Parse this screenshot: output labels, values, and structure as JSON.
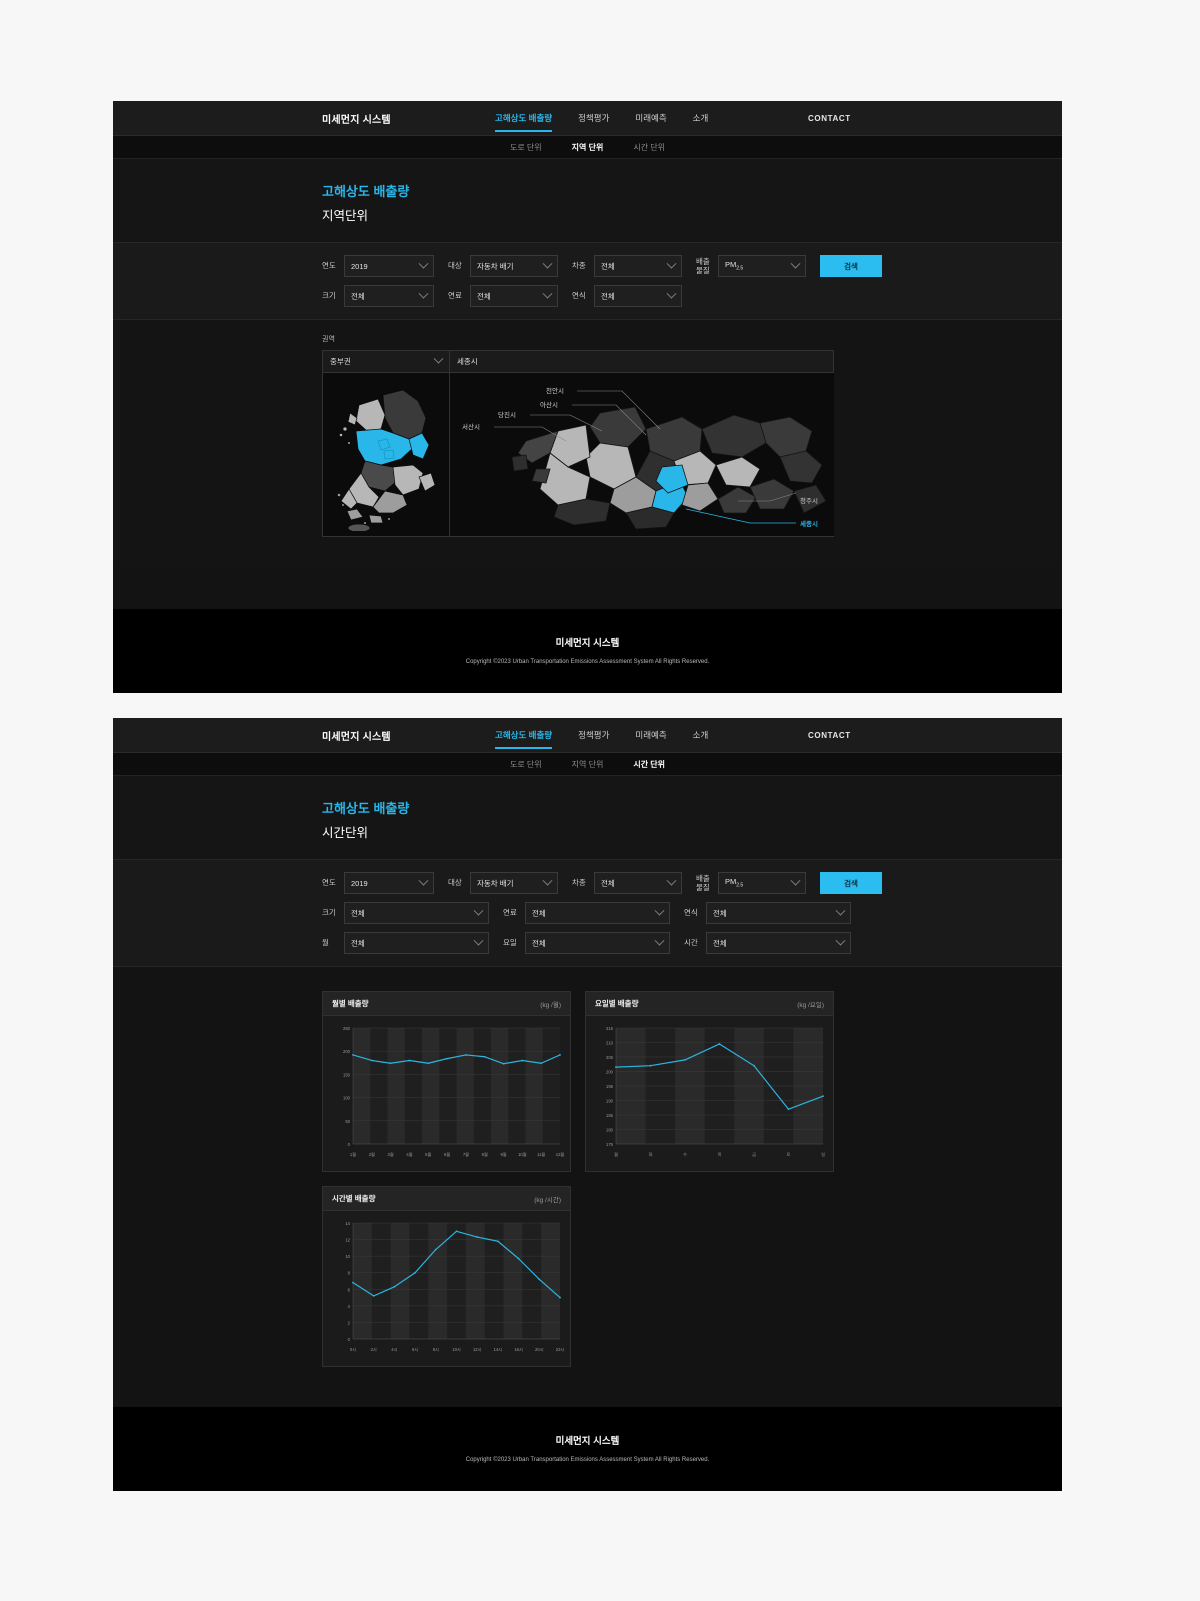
{
  "nav": {
    "brand": "미세먼지 시스템",
    "links": [
      {
        "label": "고해상도 배출량",
        "active": true
      },
      {
        "label": "정책평가",
        "active": false
      },
      {
        "label": "미래예측",
        "active": false
      },
      {
        "label": "소개",
        "active": false
      }
    ],
    "contact": "CONTACT"
  },
  "subnav": {
    "items": [
      {
        "label": "도로 단위"
      },
      {
        "label": "지역 단위"
      },
      {
        "label": "시간 단위"
      }
    ]
  },
  "region_page": {
    "heading": {
      "kicker": "고해상도 배출량",
      "title": "지역단위"
    },
    "filters": {
      "row1": [
        {
          "label": "연도",
          "value": "2019"
        },
        {
          "label": "대상",
          "value": "자동차 배기"
        },
        {
          "label": "차종",
          "value": "전체"
        },
        {
          "label": "배출\n물질",
          "value": "PM",
          "sub": "2.5"
        }
      ],
      "row2": [
        {
          "label": "크기",
          "value": "전체"
        },
        {
          "label": "연료",
          "value": "전체"
        },
        {
          "label": "연식",
          "value": "전체"
        }
      ],
      "search_label": "검색"
    },
    "map": {
      "caption": "권역",
      "region_select": "중부권",
      "city_title": "세종시",
      "labels": [
        "천안시",
        "아산시",
        "당진시",
        "서산시",
        "청주시",
        "세종시"
      ]
    }
  },
  "time_page": {
    "heading": {
      "kicker": "고해상도 배출량",
      "title": "시간단위"
    },
    "filters": {
      "row1": [
        {
          "label": "연도",
          "value": "2019"
        },
        {
          "label": "대상",
          "value": "자동차 배기"
        },
        {
          "label": "차종",
          "value": "전체"
        },
        {
          "label": "배출\n물질",
          "value": "PM",
          "sub": "2.5"
        }
      ],
      "row2": [
        {
          "label": "크기",
          "value": "전체"
        },
        {
          "label": "연료",
          "value": "전체"
        },
        {
          "label": "연식",
          "value": "전체"
        }
      ],
      "row3": [
        {
          "label": "월",
          "value": "전체"
        },
        {
          "label": "요일",
          "value": "전체"
        },
        {
          "label": "시간",
          "value": "전체"
        }
      ],
      "search_label": "검색"
    },
    "cards": [
      {
        "title": "월별 배출량",
        "unit": "(kg /월)"
      },
      {
        "title": "요일별 배출량",
        "unit": "(kg /요일)"
      },
      {
        "title": "시간별 배출량",
        "unit": "(kg /시간)"
      }
    ]
  },
  "footer": {
    "brand": "미세먼지 시스템",
    "copyright": "Copyright ©2023 Urban Transportation Emissions Assessment System All Rights Reserved."
  },
  "colors": {
    "accent": "#29b6e8",
    "line": "#2bb5e0",
    "map_highlight": "#29b6e8",
    "map_light": "#b7b7b7",
    "map_dark": "#3a3a3a"
  },
  "chart_data": [
    {
      "type": "line",
      "title": "월별 배출량",
      "unit": "(kg /월)",
      "xlabel": "",
      "ylabel": "",
      "categories": [
        "1월",
        "2월",
        "3월",
        "4월",
        "5월",
        "6월",
        "7월",
        "8월",
        "9월",
        "10월",
        "11월",
        "12월"
      ],
      "values": [
        192,
        180,
        174,
        180,
        174,
        184,
        192,
        188,
        173,
        180,
        174,
        192
      ],
      "yticks": [
        0,
        50,
        100,
        150,
        200,
        250
      ],
      "ylim": [
        0,
        250
      ],
      "grid": true,
      "legend": "none"
    },
    {
      "type": "line",
      "title": "요일별 배출량",
      "unit": "(kg /요일)",
      "xlabel": "",
      "ylabel": "",
      "categories": [
        "월",
        "화",
        "수",
        "목",
        "금",
        "토",
        "일"
      ],
      "values": [
        201.5,
        202,
        204,
        209.5,
        202,
        187,
        191.5
      ],
      "yticks": [
        175,
        180,
        185,
        190,
        195,
        200,
        205,
        210,
        215
      ],
      "ylim": [
        175,
        215
      ],
      "grid": true,
      "legend": "none"
    },
    {
      "type": "line",
      "title": "시간별 배출량",
      "unit": "(kg /시간)",
      "xlabel": "",
      "ylabel": "",
      "categories": [
        "0시",
        "2시",
        "4시",
        "6시",
        "8시",
        "10시",
        "12시",
        "14시",
        "16시",
        "20시",
        "22시"
      ],
      "values": [
        6.8,
        5.2,
        6.3,
        8.0,
        10.8,
        13.0,
        12.3,
        11.8,
        9.7,
        7.2,
        5.0
      ],
      "yticks": [
        0,
        2,
        4,
        6,
        8,
        10,
        12,
        14
      ],
      "ylim": [
        0,
        14
      ],
      "grid": true,
      "legend": "none"
    }
  ]
}
